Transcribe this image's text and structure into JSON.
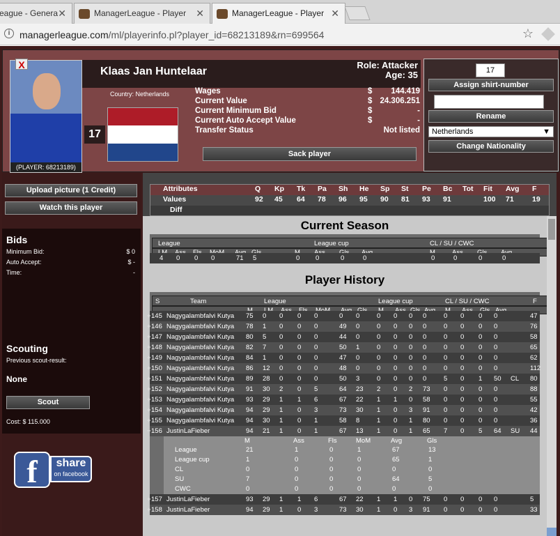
{
  "browser": {
    "tabs": [
      {
        "label": "eague - Genera"
      },
      {
        "label": "ManagerLeague - Player"
      },
      {
        "label": "ManagerLeague - Player"
      }
    ],
    "url_host": "managerleague.com",
    "url_path": "/ml/playerinfo.pl?player_id=68213189&rn=699564"
  },
  "player": {
    "name": "Klaas Jan Huntelaar",
    "role": "Role: Attacker",
    "age": "Age: 35",
    "country": "Country: Netherlands",
    "shirt": "17",
    "caption": "(PLAYER: 68213189)",
    "close_label": "X"
  },
  "finance": [
    {
      "label": "Wages",
      "cur": "$",
      "value": "144.419"
    },
    {
      "label": "Current Value",
      "cur": "$",
      "value": "24.306.251"
    },
    {
      "label": "Current Minimum Bid",
      "cur": "$",
      "value": "-"
    },
    {
      "label": "Current Auto Accept Value",
      "cur": "$",
      "value": "-"
    },
    {
      "label": "Transfer Status",
      "cur": "",
      "value": "Not listed"
    }
  ],
  "actions": {
    "sack": "Sack player",
    "assign": "Assign shirt-number",
    "shirt_value": "17",
    "rename": "Rename",
    "nationality": "Netherlands",
    "change_nat": "Change Nationality",
    "upload": "Upload picture (1 Credit)",
    "watch": "Watch this player",
    "scout": "Scout"
  },
  "bids": {
    "title": "Bids",
    "rows": [
      {
        "label": "Minimum Bid:",
        "value": "$ 0"
      },
      {
        "label": "Auto Accept:",
        "value": "$ -"
      },
      {
        "label": "Time:",
        "value": "-"
      }
    ]
  },
  "scouting": {
    "title": "Scouting",
    "prev": "Previous scout-result:",
    "result": "None",
    "cost": "Cost: $ 115.000"
  },
  "facebook": {
    "f": "f",
    "share": "share",
    "sub": "on facebook"
  },
  "attributes": {
    "headers": [
      "Attributes",
      "Q",
      "Kp",
      "Tk",
      "Pa",
      "Sh",
      "He",
      "Sp",
      "St",
      "Pe",
      "Bc",
      "Tot",
      "Fit",
      "Avg",
      "F"
    ],
    "values_label": "Values",
    "values": [
      "92",
      "45",
      "64",
      "78",
      "96",
      "95",
      "90",
      "81",
      "93",
      "91",
      "",
      "100",
      "71",
      "19"
    ],
    "diff_label": "Diff"
  },
  "current_season": {
    "title": "Current Season",
    "groups": [
      "League",
      "League cup",
      "CL / SU / CWC"
    ],
    "cols": [
      "LM",
      "Ass",
      "Fls",
      "MoM",
      "Avg",
      "Gls",
      "M",
      "Ass",
      "Gls",
      "Avg",
      "M",
      "Ass",
      "Gls",
      "Avg"
    ],
    "values": [
      "4",
      "0",
      "0",
      "0",
      "71",
      "5",
      "0",
      "0",
      "0",
      "0",
      "0",
      "0",
      "0",
      "0"
    ]
  },
  "history": {
    "title": "Player History",
    "head1": {
      "s": "S",
      "team": "Team",
      "league": "League",
      "cup": "League cup",
      "cl": "CL / SU / CWC",
      "f": "F"
    },
    "cols": [
      "M",
      "LM",
      "Ass",
      "Fls",
      "MoM",
      "Avg",
      "Gls",
      "M",
      "Ass",
      "Gls",
      "Avg",
      "M",
      "Ass",
      "Gls",
      "Avg"
    ],
    "rows": [
      [
        "145",
        "Nagygalambfalvi Kutya",
        "75",
        "0",
        "0",
        "0",
        "0",
        "0",
        "0",
        "0",
        "0",
        "0",
        "0",
        "0",
        "0",
        "0",
        "0",
        "",
        "47"
      ],
      [
        "146",
        "Nagygalambfalvi Kutya",
        "78",
        "1",
        "0",
        "0",
        "0",
        "49",
        "0",
        "0",
        "0",
        "0",
        "0",
        "0",
        "0",
        "0",
        "0",
        "",
        "76"
      ],
      [
        "147",
        "Nagygalambfalvi Kutya",
        "80",
        "5",
        "0",
        "0",
        "0",
        "44",
        "0",
        "0",
        "0",
        "0",
        "0",
        "0",
        "0",
        "0",
        "0",
        "",
        "58"
      ],
      [
        "148",
        "Nagygalambfalvi Kutya",
        "82",
        "7",
        "0",
        "0",
        "0",
        "50",
        "1",
        "0",
        "0",
        "0",
        "0",
        "0",
        "0",
        "0",
        "0",
        "",
        "65"
      ],
      [
        "149",
        "Nagygalambfalvi Kutya",
        "84",
        "1",
        "0",
        "0",
        "0",
        "47",
        "0",
        "0",
        "0",
        "0",
        "0",
        "0",
        "0",
        "0",
        "0",
        "",
        "62"
      ],
      [
        "150",
        "Nagygalambfalvi Kutya",
        "86",
        "12",
        "0",
        "0",
        "0",
        "48",
        "0",
        "0",
        "0",
        "0",
        "0",
        "0",
        "0",
        "0",
        "0",
        "",
        "112"
      ],
      [
        "151",
        "Nagygalambfalvi Kutya",
        "89",
        "28",
        "0",
        "0",
        "0",
        "50",
        "3",
        "0",
        "0",
        "0",
        "0",
        "5",
        "0",
        "1",
        "50",
        "CL",
        "80"
      ],
      [
        "152",
        "Nagygalambfalvi Kutya",
        "91",
        "30",
        "2",
        "0",
        "5",
        "64",
        "23",
        "2",
        "0",
        "2",
        "73",
        "0",
        "0",
        "0",
        "0",
        "",
        "88"
      ],
      [
        "153",
        "Nagygalambfalvi Kutya",
        "93",
        "29",
        "1",
        "1",
        "6",
        "67",
        "22",
        "1",
        "1",
        "0",
        "58",
        "0",
        "0",
        "0",
        "0",
        "",
        "55"
      ],
      [
        "154",
        "Nagygalambfalvi Kutya",
        "94",
        "29",
        "1",
        "0",
        "3",
        "73",
        "30",
        "1",
        "0",
        "3",
        "91",
        "0",
        "0",
        "0",
        "0",
        "",
        "42"
      ],
      [
        "155",
        "Nagygalambfalvi Kutya",
        "94",
        "30",
        "1",
        "0",
        "1",
        "58",
        "8",
        "1",
        "0",
        "1",
        "80",
        "0",
        "0",
        "0",
        "0",
        "",
        "36"
      ],
      [
        "156",
        "JustinLaFieber",
        "94",
        "21",
        "1",
        "0",
        "1",
        "67",
        "13",
        "1",
        "0",
        "1",
        "65",
        "7",
        "0",
        "5",
        "64",
        "SU",
        "44"
      ]
    ],
    "detail_cols": [
      "M",
      "Ass",
      "Fls",
      "MoM",
      "Avg",
      "Gls"
    ],
    "detail": [
      [
        "League",
        "21",
        "1",
        "0",
        "1",
        "67",
        "13"
      ],
      [
        "League cup",
        "1",
        "0",
        "0",
        "0",
        "65",
        "1"
      ],
      [
        "CL",
        "0",
        "0",
        "0",
        "0",
        "0",
        "0"
      ],
      [
        "SU",
        "7",
        "0",
        "0",
        "0",
        "64",
        "5"
      ],
      [
        "CWC",
        "0",
        "0",
        "0",
        "0",
        "0",
        "0"
      ]
    ],
    "rows2": [
      [
        "157",
        "JustinLaFieber",
        "93",
        "29",
        "1",
        "1",
        "6",
        "67",
        "22",
        "1",
        "1",
        "0",
        "75",
        "0",
        "0",
        "0",
        "0",
        "",
        "5"
      ],
      [
        "158",
        "JustinLaFieber",
        "94",
        "29",
        "1",
        "0",
        "3",
        "73",
        "30",
        "1",
        "0",
        "3",
        "91",
        "0",
        "0",
        "0",
        "0",
        "",
        "33"
      ]
    ]
  },
  "colors": {
    "maroon": "#7d4546",
    "dark": "#3d1b1b",
    "flag_red": "#ae1c28",
    "flag_white": "#ffffff",
    "flag_blue": "#21468b"
  }
}
